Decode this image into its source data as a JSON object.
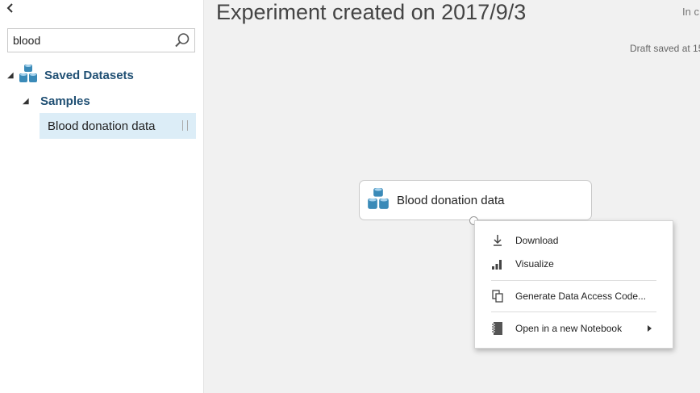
{
  "sidebar": {
    "collapse_icon": "chevron-left-icon",
    "search": {
      "value": "blood",
      "icon": "search-icon"
    },
    "tree": {
      "root_label": "Saved Datasets",
      "child_label": "Samples",
      "item_label": "Blood donation data"
    }
  },
  "main": {
    "title": "Experiment created on 2017/9/3",
    "status_partial": "In c",
    "draft_status": "Draft saved at 15",
    "module": {
      "label": "Blood donation data",
      "icon": "dataset-icon"
    }
  },
  "context_menu": {
    "items": [
      {
        "label": "Download",
        "icon": "download-icon"
      },
      {
        "label": "Visualize",
        "icon": "bar-chart-icon"
      },
      {
        "label": "Generate Data Access Code...",
        "icon": "copy-code-icon"
      },
      {
        "label": "Open in a new Notebook",
        "icon": "notebook-icon"
      }
    ]
  },
  "colors": {
    "accent": "#1f4f73",
    "selection": "#dcedf7",
    "dataset_icon": "#3a8ab8"
  }
}
